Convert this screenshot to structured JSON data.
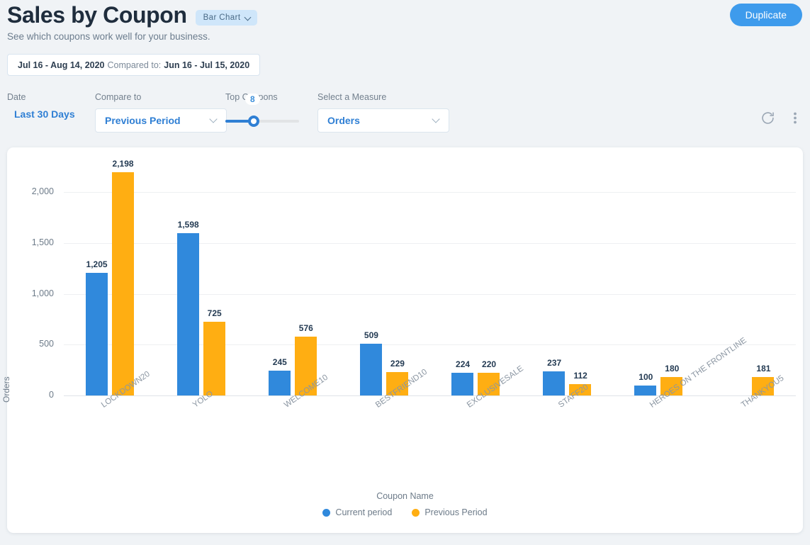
{
  "header": {
    "title": "Sales by Coupon",
    "chart_type_pill": "Bar Chart",
    "subtitle": "See which coupons work well for your business.",
    "duplicate_label": "Duplicate"
  },
  "date_bar": {
    "current_range": "Jul 16 - Aug 14, 2020",
    "compare_text": "Compared to:",
    "compare_range": "Jun 16 - Jul 15, 2020"
  },
  "controls": {
    "date": {
      "label": "Date",
      "value": "Last 30 Days"
    },
    "compare_to": {
      "label": "Compare to",
      "value": "Previous Period"
    },
    "top_coupons": {
      "label": "Top Coupons",
      "value": "8"
    },
    "measure": {
      "label": "Select a Measure",
      "value": "Orders"
    },
    "refresh_icon": "refresh-icon",
    "more_icon": "more-vertical-icon"
  },
  "colors": {
    "current": "#3089dc",
    "previous": "#ffae12",
    "accent": "#3e9bec",
    "page_bg": "#f0f3f6"
  },
  "chart_data": {
    "type": "bar",
    "title": "Sales by Coupon",
    "xlabel": "Coupon Name",
    "ylabel": "Orders",
    "ylim": [
      0,
      2300
    ],
    "yticks": [
      "0",
      "500",
      "1,000",
      "1,500",
      "2,000"
    ],
    "ytick_values": [
      0,
      500,
      1000,
      1500,
      2000
    ],
    "grid": true,
    "legend_position": "bottom",
    "categories": [
      "LOCKDOWN20",
      "YOLO",
      "WELCOME10",
      "BESTFRIEND10",
      "EXCLUSIVESALE",
      "STAFF20",
      "HEROES ON THE FRONTLINE",
      "THANKYOU5"
    ],
    "series": [
      {
        "name": "Current period",
        "color": "#3089dc",
        "values": [
          1205,
          1598,
          245,
          509,
          224,
          237,
          100,
          null
        ],
        "labels": [
          "1,205",
          "1,598",
          "245",
          "509",
          "224",
          "237",
          "100",
          ""
        ]
      },
      {
        "name": "Previous Period",
        "color": "#ffae12",
        "values": [
          2198,
          725,
          576,
          229,
          220,
          112,
          180,
          181
        ],
        "labels": [
          "2,198",
          "725",
          "576",
          "229",
          "220",
          "112",
          "180",
          "181"
        ]
      }
    ]
  }
}
